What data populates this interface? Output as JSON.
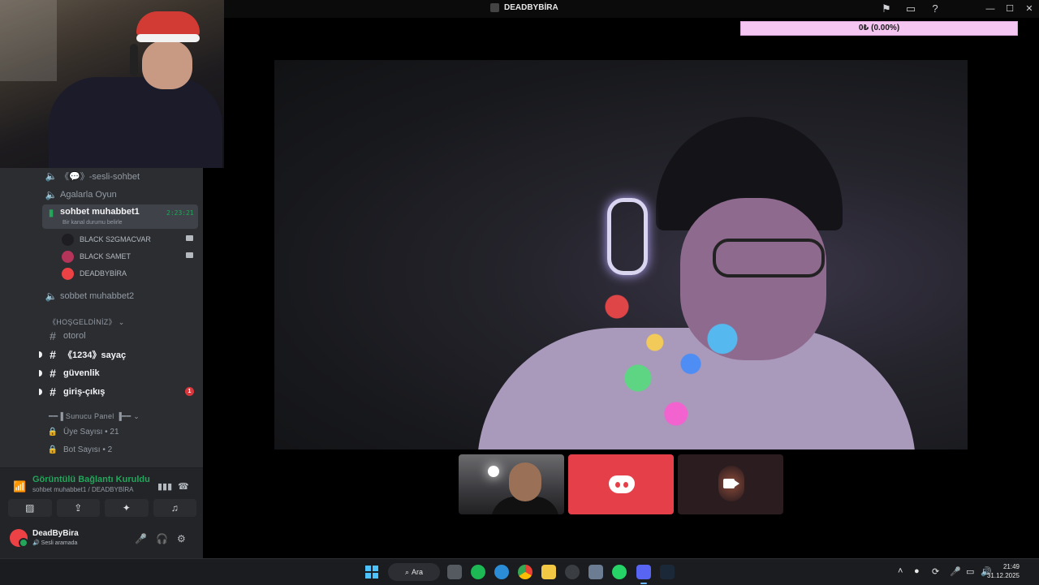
{
  "window": {
    "title": "DEADBYBİRA",
    "controls": [
      "—",
      "☐",
      "✕"
    ],
    "titlebar_icons": [
      "inbox-icon",
      "screen-icon",
      "help-icon"
    ]
  },
  "sidebar": {
    "voice_channels_top": [
      {
        "label": "《💬》-sesli-sohbet",
        "icon": "speaker-icon"
      },
      {
        "label": "Agalarla Oyun",
        "icon": "speaker-icon"
      }
    ],
    "active_channel": {
      "label": "sohbet muhabbet1",
      "status": "Bir kanal durumu belirle",
      "timer": "2:23:21"
    },
    "voice_users": [
      {
        "name": "BLACK S2GMACVAR",
        "avatar_color": "#1e1e22",
        "camera": true
      },
      {
        "name": "BLACK SAMET",
        "avatar_color": "#b5345a",
        "camera": true
      },
      {
        "name": "DEADBYBİRA",
        "avatar_color": "#ed4245",
        "camera": false
      }
    ],
    "voice_channels_after": [
      {
        "label": "sobbet muhabbet2",
        "icon": "speaker-icon"
      }
    ],
    "category_welcome": "《HOŞGELDİNİZ》",
    "text_channels": [
      {
        "label": "otorol",
        "unread": false,
        "mention": ""
      },
      {
        "label": "《1234》sayaç",
        "unread": true,
        "mention": ""
      },
      {
        "label": "güvenlik",
        "unread": true,
        "mention": ""
      },
      {
        "label": "giriş-çıkış",
        "unread": true,
        "mention": "1"
      }
    ],
    "category_panel": "━━▐ Sunucu Panel ▐━━",
    "stat_channels": [
      {
        "label": "Üye Sayısı • 21"
      },
      {
        "label": "Bot Sayısı • 2"
      }
    ]
  },
  "voice_panel": {
    "title": "Görüntülü Bağlantı Kuruldu",
    "subtitle": "sohbet muhabbet1 / DEADBYBİRA",
    "buttons": [
      "camera-off-icon",
      "screen-share-icon",
      "activity-icon",
      "soundboard-icon"
    ]
  },
  "user": {
    "name": "DeadByBira",
    "status": "🔊 Sesli aramada"
  },
  "overlay": {
    "progress_text": "0₺ (0.00%)",
    "progress_fraction": 0.0
  },
  "taskbar": {
    "search_label": "Ara",
    "apps": [
      "task-view",
      "spotify",
      "edge",
      "chrome",
      "file-explorer",
      "app-1",
      "app-2",
      "whatsapp",
      "discord",
      "steam"
    ],
    "time": "21:49",
    "date": "31.12.2025"
  },
  "colors": {
    "sidebar_bg": "#2b2d31",
    "panel_bg": "#232428",
    "active_green": "#23a55a",
    "mention_red": "#da373c",
    "discord_tile": "#e5404a",
    "progress_bg": "#f6c6f3"
  }
}
